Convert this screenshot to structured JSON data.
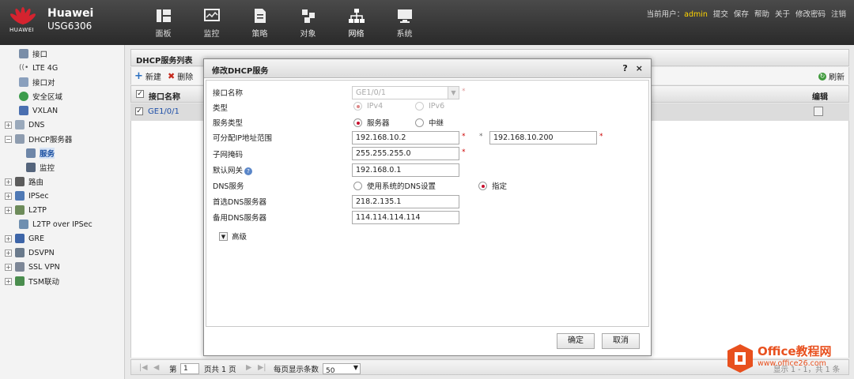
{
  "brand": {
    "logo_text": "HUAWEI",
    "name": "Huawei",
    "model": "USG6306"
  },
  "nav": [
    {
      "label": "面板",
      "icon": "dashboard-icon"
    },
    {
      "label": "监控",
      "icon": "monitor-icon"
    },
    {
      "label": "策略",
      "icon": "policy-icon"
    },
    {
      "label": "对象",
      "icon": "object-icon"
    },
    {
      "label": "网络",
      "icon": "network-icon"
    },
    {
      "label": "系统",
      "icon": "system-icon"
    }
  ],
  "topright": {
    "user_prefix": "当前用户：",
    "user": "admin",
    "links": [
      "提交",
      "保存",
      "帮助",
      "关于",
      "修改密码",
      "注销"
    ]
  },
  "sidebar": [
    {
      "label": "接口"
    },
    {
      "label": "LTE 4G"
    },
    {
      "label": "接口对"
    },
    {
      "label": "安全区域"
    },
    {
      "label": "VXLAN"
    },
    {
      "label": "DNS"
    },
    {
      "label": "DHCP服务器"
    },
    {
      "label": "服务"
    },
    {
      "label": "监控"
    },
    {
      "label": "路由"
    },
    {
      "label": "IPSec"
    },
    {
      "label": "L2TP"
    },
    {
      "label": "L2TP over IPSec"
    },
    {
      "label": "GRE"
    },
    {
      "label": "DSVPN"
    },
    {
      "label": "SSL VPN"
    },
    {
      "label": "TSM联动"
    }
  ],
  "panel": {
    "title": "DHCP服务列表",
    "new_label": "新建",
    "delete_label": "删除",
    "refresh_label": "刷新",
    "col_interface": "接口名称",
    "col_edit": "编辑",
    "rows": [
      {
        "interface": "GE1/0/1"
      }
    ]
  },
  "pager": {
    "page_prefix": "第",
    "page": "1",
    "page_suffix": "页共 1 页",
    "per_page_label": "每页显示条数",
    "per_page": "50",
    "summary": "显示 1 - 1，共 1 条"
  },
  "modal": {
    "title": "修改DHCP服务",
    "help": "?",
    "close": "×",
    "labels": {
      "interface": "接口名称",
      "type": "类型",
      "service_type": "服务类型",
      "ip_range": "可分配IP地址范围",
      "subnet": "子网掩码",
      "gateway": "默认网关",
      "dns_service": "DNS服务",
      "primary_dns": "首选DNS服务器",
      "secondary_dns": "备用DNS服务器"
    },
    "values": {
      "interface": "GE1/0/1",
      "ip_start": "192.168.10.2",
      "ip_end": "192.168.10.200",
      "subnet": "255.255.255.0",
      "gateway": "192.168.0.1",
      "primary_dns": "218.2.135.1",
      "secondary_dns": "114.114.114.114"
    },
    "options": {
      "ipv4": "IPv4",
      "ipv6": "IPv6",
      "server": "服务器",
      "relay": "中继",
      "dns_system": "使用系统的DNS设置",
      "dns_specify": "指定"
    },
    "selected": {
      "type": "IPv4",
      "service_type": "服务器",
      "dns_service": "指定"
    },
    "range_sep": "*",
    "advanced": "高级",
    "ok": "确定",
    "cancel": "取消"
  },
  "watermark": {
    "title": "Office教程网",
    "url": "www.office26.com"
  }
}
